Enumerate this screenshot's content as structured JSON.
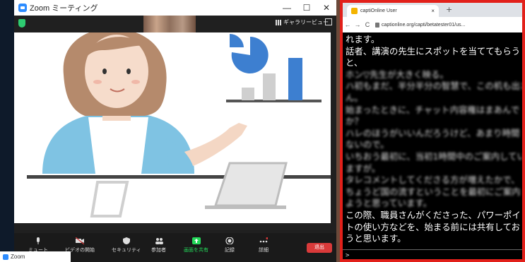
{
  "zoom": {
    "title": "Zoom ミーティング",
    "window_controls": [
      "—",
      "☐",
      "✕"
    ],
    "gallery_view_label": "ギャラリービュー",
    "toolbar": [
      {
        "label": "ミュート",
        "icon": "mic-icon"
      },
      {
        "label": "ビデオの開始",
        "icon": "video-icon"
      },
      {
        "label": "セキュリティ",
        "icon": "shield-icon"
      },
      {
        "label": "参加者",
        "icon": "participants-icon"
      },
      {
        "label": "画面を共有",
        "icon": "share-screen-icon"
      },
      {
        "label": "記録",
        "icon": "record-icon"
      },
      {
        "label": "詳細",
        "icon": "more-icon"
      }
    ],
    "more_badge": "1",
    "end_label": "退出",
    "accent": "#2d8cff",
    "share_color": "#23d959",
    "end_color": "#d93a3a"
  },
  "taskbar": {
    "label": "Zoom"
  },
  "browser": {
    "tab_title": "captiOnline User",
    "tab_close": "×",
    "new_tab": "+",
    "nav": [
      "←",
      "→",
      "C"
    ],
    "url": "captionline.org/capti/betatester01/us...",
    "border_color": "#e2201a",
    "caption_lines": [
      "れます。",
      "話者、講演の先生にスポットを当ててもらう",
      "と、",
      "ホン▽先生が大きく映る。",
      "ハ初もまだ、半分半分の智慧で、この机も出さ",
      "ん。",
      "始まったときに、チャット内容権はまあんで",
      "か？",
      "ハレのほうがいいんだろうけど、あまり時間",
      "ないので。",
      "いちおう最初に、当初1時間中のご案内してい",
      "ますが。",
      "タレコメントしてくださる方が増えたかで、",
      "ちょうど国の流すということを最初にご案内",
      "ようと思っています。",
      "この際、職員さんがくださった、パワーポイ",
      "トの使い方などを、始まる前には共有してお",
      "うと思います。"
    ],
    "input_prompt": ">"
  }
}
